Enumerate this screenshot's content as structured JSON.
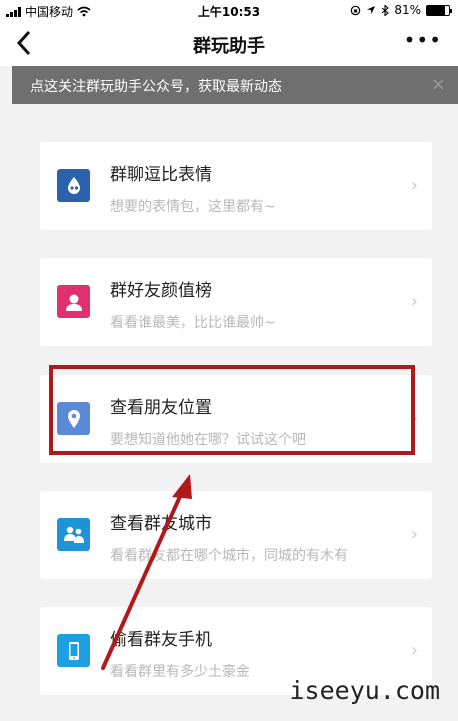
{
  "status_bar": {
    "carrier": "中国移动",
    "time": "上午10:53",
    "battery": "81%",
    "battery_level": 0.81
  },
  "nav": {
    "back_icon": "chevron-left-icon",
    "title": "群玩助手",
    "more_label": "•••"
  },
  "notice": {
    "text": "点这关注群玩助手公众号，获取最新动态",
    "close_label": "×"
  },
  "cards": [
    {
      "title": "群聊逗比表情",
      "subtitle": "想要的表情包，这里都有~",
      "icon": "emoji-drop-icon",
      "color": "#2a62ad"
    },
    {
      "title": "群好友颜值榜",
      "subtitle": "看看谁最美，比比谁最帅~",
      "icon": "person-icon",
      "color": "#e0306e"
    },
    {
      "title": "查看朋友位置",
      "subtitle": "要想知道他她在哪？试试这个吧",
      "icon": "location-pin-icon",
      "color": "#5b89d6"
    },
    {
      "title": "查看群友城市",
      "subtitle": "看看群友都在哪个城市，同城的有木有",
      "icon": "group-people-icon",
      "color": "#1f93d8"
    },
    {
      "title": "偷看群友手机",
      "subtitle": "看看群里有多少土豪金",
      "icon": "phone-icon",
      "color": "#1e9fe0"
    }
  ],
  "chevron": "›",
  "watermark": "iseeyu.com",
  "colors": {
    "highlight_border": "#b0191a",
    "arrow": "#b0191a"
  }
}
